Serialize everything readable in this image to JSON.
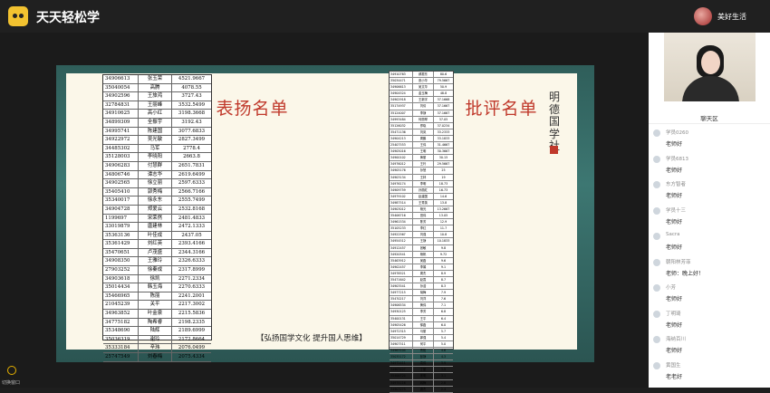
{
  "app": {
    "title": "天天轻松学",
    "user_name": "美好生活"
  },
  "slide": {
    "praise_title": "表扬名单",
    "criticize_title": "批评名单",
    "vertical_text": "明德国学社",
    "slogan": "【弘扬国学文化  提升国人思维】",
    "praise_rows": [
      [
        "34906613",
        "张玉荣",
        "4521.9667"
      ],
      [
        "35040054",
        "高腾",
        "4078.55"
      ],
      [
        "34902596",
        "王旅鸿",
        "3727.43"
      ],
      [
        "32784831",
        "王丽峰",
        "3532.5499"
      ],
      [
        "34910625",
        "高小红",
        "3198.3668"
      ],
      [
        "34899309",
        "全振宇",
        "3192.43"
      ],
      [
        "34995741",
        "陈建国",
        "3077.6833"
      ],
      [
        "34922972",
        "吴光敏",
        "2827.3499"
      ],
      [
        "34485302",
        "马军",
        "2778.4"
      ],
      [
        "35128003",
        "李晓阳",
        "2663.8"
      ],
      [
        "34906283",
        "付慧群",
        "2651.7831"
      ],
      [
        "34806746",
        "谭志华",
        "2619.6499"
      ],
      [
        "34902565",
        "徐立丽",
        "2597.6333"
      ],
      [
        "35405410",
        "郭秀梅",
        "2566.7166"
      ],
      [
        "35340017",
        "徐永东",
        "2555.7499"
      ],
      [
        "34904728",
        "郑爱云",
        "2532.8168"
      ],
      [
        "1199697",
        "宋荣然",
        "2481.4833"
      ],
      [
        "33019879",
        "唐建林",
        "2472.1333"
      ],
      [
        "35363136",
        "叶佳成",
        "2437.05"
      ],
      [
        "35361429",
        "刘红英",
        "2393.4166"
      ],
      [
        "35470651",
        "卢茂盛",
        "2344.3166"
      ],
      [
        "34908350",
        "王雅玲",
        "2326.6333"
      ],
      [
        "27903252",
        "徐秦成",
        "2317.8999"
      ],
      [
        "34903618",
        "徐凯",
        "2271.2334"
      ],
      [
        "35014434",
        "韩玉海",
        "2270.6333"
      ],
      [
        "35466965",
        "陈丽",
        "2241.2001"
      ],
      [
        "21045239",
        "关平",
        "2217.3002"
      ],
      [
        "34963852",
        "叶金泉",
        "2215.5836"
      ],
      [
        "34775182",
        "陶希睿",
        "2198.2335"
      ],
      [
        "35348690",
        "陆辉",
        "2189.6999"
      ],
      [
        "35036319",
        "谢玲",
        "2172.8664"
      ],
      [
        "35333184",
        "辛玮",
        "2076.0499"
      ],
      [
        "25747549",
        "刘春梅",
        "2075.4334"
      ]
    ],
    "criticize_rows": [
      [
        "34910763",
        "郝振东",
        "80.6"
      ],
      [
        "35034471",
        "张小华",
        "79.5667"
      ],
      [
        "34906613",
        "吴文华",
        "50.9"
      ],
      [
        "34904524",
        "金玉梅",
        "48.8"
      ],
      [
        "34902918",
        "王新宇",
        "37.1668"
      ],
      [
        "35174937",
        "刘倩",
        "37.1667"
      ],
      [
        "35124007",
        "李静",
        "37.1667"
      ],
      [
        "34993484",
        "何丽琴",
        "37.05"
      ],
      [
        "35126032",
        "郑晓",
        "37.0234"
      ],
      [
        "35471136",
        "刘岚",
        "33.2333"
      ],
      [
        "34904213",
        "周鹏",
        "33.1833"
      ],
      [
        "25407553",
        "王伟",
        "31.4667"
      ],
      [
        "34905016",
        "王明",
        "30.3667"
      ],
      [
        "34900102",
        "黄丽",
        "30.15"
      ],
      [
        "34976012",
        "王玲",
        "29.5667"
      ],
      [
        "34905176",
        "孙慧",
        "25"
      ],
      [
        "34903134",
        "王林",
        "19"
      ],
      [
        "34976174",
        "李明",
        "18.73"
      ],
      [
        "34909759",
        "孙丽红",
        "16.73"
      ],
      [
        "34979102",
        "赵建国",
        "14.6"
      ],
      [
        "34987514",
        "王秀英",
        "13.8"
      ],
      [
        "34903012",
        "杨光",
        "13.2667"
      ],
      [
        "35406716",
        "田伟",
        "13.05"
      ],
      [
        "34961534",
        "陈芳",
        "12.9"
      ],
      [
        "35105233",
        "李红",
        "11.7"
      ],
      [
        "34922567",
        "刘强",
        "10.8"
      ],
      [
        "34954512",
        "王静",
        "10.1833"
      ],
      [
        "34912457",
        "张敏",
        "9.8"
      ],
      [
        "34920541",
        "杨帆",
        "9.72"
      ],
      [
        "35463912",
        "吴磊",
        "9.6"
      ],
      [
        "34902457",
        "李娟",
        "9.1"
      ],
      [
        "34978521",
        "周杰",
        "8.9"
      ],
      [
        "35471642",
        "赵霞",
        "8.7"
      ],
      [
        "34903541",
        "孙浩",
        "8.3"
      ],
      [
        "34977215",
        "胡梅",
        "7.9"
      ],
      [
        "35470217",
        "刘洋",
        "7.6"
      ],
      [
        "34906534",
        "黄伟",
        "7.1"
      ],
      [
        "34930125",
        "李芳",
        "6.8"
      ],
      [
        "35400131",
        "王平",
        "6.4"
      ],
      [
        "34905426",
        "徐磊",
        "6.0"
      ],
      [
        "34972315",
        "马丽",
        "5.7"
      ],
      [
        "35014729",
        "郭强",
        "5.4"
      ],
      [
        "34907511",
        "何平",
        "5.0"
      ],
      [
        "34963104",
        "曹阳",
        "4.6"
      ],
      [
        "35035172",
        "彭静",
        "4.3"
      ],
      [
        "34972411",
        "袁伟",
        "3.9"
      ],
      [
        "34903427",
        "丁丽",
        "3.5"
      ],
      [
        "35406724",
        "宋明",
        "3.1"
      ],
      [
        "34974116",
        "韩梅",
        "2.8"
      ],
      [
        "34903275",
        "唐杰",
        "2.4"
      ]
    ]
  },
  "bottom": {
    "label": "切换窗口"
  },
  "sidebar": {
    "chat_title": "聊天区",
    "messages": [
      {
        "name": "学员0260",
        "text": "老师好"
      },
      {
        "name": "学员6813",
        "text": "老师好"
      },
      {
        "name": "东方智者",
        "text": "老师好"
      },
      {
        "name": "学员十三",
        "text": "老师好"
      },
      {
        "name": "Sacra",
        "text": "老师好"
      },
      {
        "name": "朝阳林芳菲",
        "text": "老师：晚上好！"
      },
      {
        "name": "小芳",
        "text": "老师好"
      },
      {
        "name": "丁明琦",
        "text": "老师好"
      },
      {
        "name": "海纳百川",
        "text": "老师好"
      },
      {
        "name": "黄国生",
        "text": "老老好"
      }
    ]
  },
  "colors": {
    "accent_red": "#c0392b",
    "logo_yellow": "#f2c230"
  },
  "icons": {
    "logo": "cartoon-face-icon",
    "bottom": "switch-window-icon"
  }
}
